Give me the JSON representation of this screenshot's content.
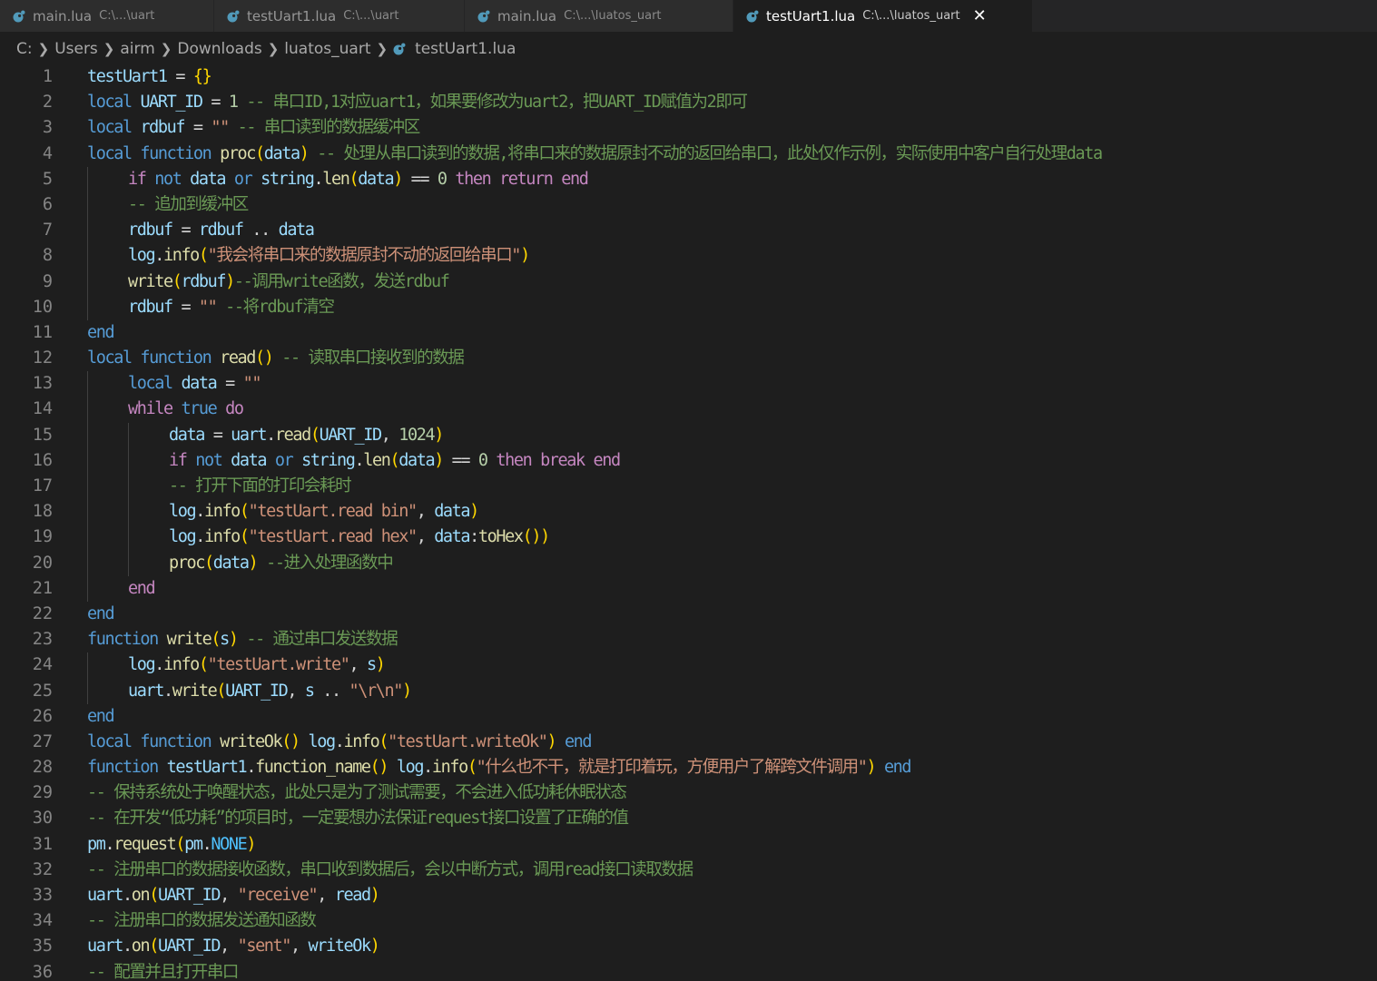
{
  "tabs": [
    {
      "name": "main.lua",
      "path": "C:\\...\\uart",
      "active": false
    },
    {
      "name": "testUart1.lua",
      "path": "C:\\...\\uart",
      "active": false
    },
    {
      "name": "main.lua",
      "path": "C:\\...\\luatos_uart",
      "active": false
    },
    {
      "name": "testUart1.lua",
      "path": "C:\\...\\luatos_uart",
      "active": true
    }
  ],
  "breadcrumb": [
    "C:",
    "Users",
    "airm",
    "Downloads",
    "luatos_uart",
    "testUart1.lua"
  ],
  "colors": {
    "editor_bg": "#1e1e1e",
    "lua_icon": "#519aba"
  },
  "editor": {
    "lines": [
      {
        "n": "1",
        "i": 0,
        "t": [
          [
            "var",
            "testUart1"
          ],
          [
            "op",
            " = "
          ],
          [
            "br",
            "{}"
          ]
        ]
      },
      {
        "n": "2",
        "i": 0,
        "t": [
          [
            "kw",
            "local "
          ],
          [
            "var",
            "UART_ID"
          ],
          [
            "op",
            " = "
          ],
          [
            "num",
            "1"
          ],
          [
            "cm",
            " -- 串口ID,1对应uart1，如果要修改为uart2，把UART_ID赋值为2即可"
          ]
        ]
      },
      {
        "n": "3",
        "i": 0,
        "t": [
          [
            "kw",
            "local "
          ],
          [
            "var",
            "rdbuf"
          ],
          [
            "op",
            " = "
          ],
          [
            "str",
            "\"\""
          ],
          [
            "cm",
            " -- 串口读到的数据缓冲区"
          ]
        ]
      },
      {
        "n": "4",
        "i": 0,
        "t": [
          [
            "kw",
            "local function "
          ],
          [
            "fn",
            "proc"
          ],
          [
            "br",
            "("
          ],
          [
            "var",
            "data"
          ],
          [
            "br",
            ")"
          ],
          [
            "cm",
            " -- 处理从串口读到的数据,将串口来的数据原封不动的返回给串口，此处仅作示例，实际使用中客户自行处理data"
          ]
        ]
      },
      {
        "n": "5",
        "i": 1,
        "t": [
          [
            "ctl",
            "if "
          ],
          [
            "kw",
            "not "
          ],
          [
            "var",
            "data"
          ],
          [
            "kw",
            " or "
          ],
          [
            "var",
            "string"
          ],
          [
            "op",
            "."
          ],
          [
            "fn",
            "len"
          ],
          [
            "br",
            "("
          ],
          [
            "var",
            "data"
          ],
          [
            "br",
            ")"
          ],
          [
            "op",
            " == "
          ],
          [
            "num",
            "0"
          ],
          [
            "ctl",
            " then return end"
          ]
        ]
      },
      {
        "n": "6",
        "i": 1,
        "t": [
          [
            "cm",
            "-- 追加到缓冲区"
          ]
        ]
      },
      {
        "n": "7",
        "i": 1,
        "t": [
          [
            "var",
            "rdbuf"
          ],
          [
            "op",
            " = "
          ],
          [
            "var",
            "rdbuf"
          ],
          [
            "op",
            " .. "
          ],
          [
            "var",
            "data"
          ]
        ]
      },
      {
        "n": "8",
        "i": 1,
        "t": [
          [
            "var",
            "log"
          ],
          [
            "op",
            "."
          ],
          [
            "fn",
            "info"
          ],
          [
            "br",
            "("
          ],
          [
            "str",
            "\"我会将串口来的数据原封不动的返回给串口\""
          ],
          [
            "br",
            ")"
          ]
        ]
      },
      {
        "n": "9",
        "i": 1,
        "t": [
          [
            "fn",
            "write"
          ],
          [
            "br",
            "("
          ],
          [
            "var",
            "rdbuf"
          ],
          [
            "br",
            ")"
          ],
          [
            "cm",
            "--调用write函数，发送rdbuf"
          ]
        ]
      },
      {
        "n": "10",
        "i": 1,
        "t": [
          [
            "var",
            "rdbuf"
          ],
          [
            "op",
            " = "
          ],
          [
            "str",
            "\"\""
          ],
          [
            "cm",
            " --将rdbuf清空"
          ]
        ]
      },
      {
        "n": "11",
        "i": 0,
        "t": [
          [
            "kw",
            "end"
          ]
        ]
      },
      {
        "n": "12",
        "i": 0,
        "t": [
          [
            "kw",
            "local function "
          ],
          [
            "fn",
            "read"
          ],
          [
            "br",
            "()"
          ],
          [
            "cm",
            " -- 读取串口接收到的数据"
          ]
        ]
      },
      {
        "n": "13",
        "i": 1,
        "t": [
          [
            "kw",
            "local "
          ],
          [
            "var",
            "data"
          ],
          [
            "op",
            " = "
          ],
          [
            "str",
            "\"\""
          ]
        ]
      },
      {
        "n": "14",
        "i": 1,
        "t": [
          [
            "ctl",
            "while "
          ],
          [
            "kw",
            "true "
          ],
          [
            "ctl",
            "do"
          ]
        ]
      },
      {
        "n": "15",
        "i": 2,
        "t": [
          [
            "var",
            "data"
          ],
          [
            "op",
            " = "
          ],
          [
            "var",
            "uart"
          ],
          [
            "op",
            "."
          ],
          [
            "fn",
            "read"
          ],
          [
            "br",
            "("
          ],
          [
            "var",
            "UART_ID"
          ],
          [
            "op",
            ", "
          ],
          [
            "num",
            "1024"
          ],
          [
            "br",
            ")"
          ]
        ]
      },
      {
        "n": "16",
        "i": 2,
        "t": [
          [
            "ctl",
            "if "
          ],
          [
            "kw",
            "not "
          ],
          [
            "var",
            "data"
          ],
          [
            "kw",
            " or "
          ],
          [
            "var",
            "string"
          ],
          [
            "op",
            "."
          ],
          [
            "fn",
            "len"
          ],
          [
            "br",
            "("
          ],
          [
            "var",
            "data"
          ],
          [
            "br",
            ")"
          ],
          [
            "op",
            " == "
          ],
          [
            "num",
            "0"
          ],
          [
            "ctl",
            " then break end"
          ]
        ]
      },
      {
        "n": "17",
        "i": 2,
        "t": [
          [
            "cm",
            "-- 打开下面的打印会耗时"
          ]
        ]
      },
      {
        "n": "18",
        "i": 2,
        "t": [
          [
            "var",
            "log"
          ],
          [
            "op",
            "."
          ],
          [
            "fn",
            "info"
          ],
          [
            "br",
            "("
          ],
          [
            "str",
            "\"testUart.read bin\""
          ],
          [
            "op",
            ", "
          ],
          [
            "var",
            "data"
          ],
          [
            "br",
            ")"
          ]
        ]
      },
      {
        "n": "19",
        "i": 2,
        "t": [
          [
            "var",
            "log"
          ],
          [
            "op",
            "."
          ],
          [
            "fn",
            "info"
          ],
          [
            "br",
            "("
          ],
          [
            "str",
            "\"testUart.read hex\""
          ],
          [
            "op",
            ", "
          ],
          [
            "var",
            "data"
          ],
          [
            "op",
            ":"
          ],
          [
            "fn",
            "toHex"
          ],
          [
            "br",
            "()"
          ],
          [
            "br",
            ")"
          ]
        ]
      },
      {
        "n": "20",
        "i": 2,
        "t": [
          [
            "fn",
            "proc"
          ],
          [
            "br",
            "("
          ],
          [
            "var",
            "data"
          ],
          [
            "br",
            ")"
          ],
          [
            "cm",
            " --进入处理函数中"
          ]
        ]
      },
      {
        "n": "21",
        "i": 1,
        "t": [
          [
            "ctl",
            "end"
          ]
        ]
      },
      {
        "n": "22",
        "i": 0,
        "t": [
          [
            "kw",
            "end"
          ]
        ]
      },
      {
        "n": "23",
        "i": 0,
        "t": [
          [
            "kw",
            "function "
          ],
          [
            "fn",
            "write"
          ],
          [
            "br",
            "("
          ],
          [
            "var",
            "s"
          ],
          [
            "br",
            ")"
          ],
          [
            "cm",
            " -- 通过串口发送数据"
          ]
        ]
      },
      {
        "n": "24",
        "i": 1,
        "t": [
          [
            "var",
            "log"
          ],
          [
            "op",
            "."
          ],
          [
            "fn",
            "info"
          ],
          [
            "br",
            "("
          ],
          [
            "str",
            "\"testUart.write\""
          ],
          [
            "op",
            ", "
          ],
          [
            "var",
            "s"
          ],
          [
            "br",
            ")"
          ]
        ]
      },
      {
        "n": "25",
        "i": 1,
        "t": [
          [
            "var",
            "uart"
          ],
          [
            "op",
            "."
          ],
          [
            "fn",
            "write"
          ],
          [
            "br",
            "("
          ],
          [
            "var",
            "UART_ID"
          ],
          [
            "op",
            ", "
          ],
          [
            "var",
            "s"
          ],
          [
            "op",
            " .. "
          ],
          [
            "str",
            "\"\\r\\n\""
          ],
          [
            "br",
            ")"
          ]
        ]
      },
      {
        "n": "26",
        "i": 0,
        "t": [
          [
            "kw",
            "end"
          ]
        ]
      },
      {
        "n": "27",
        "i": 0,
        "t": [
          [
            "kw",
            "local function "
          ],
          [
            "fn",
            "writeOk"
          ],
          [
            "br",
            "()"
          ],
          [
            "op",
            " "
          ],
          [
            "var",
            "log"
          ],
          [
            "op",
            "."
          ],
          [
            "fn",
            "info"
          ],
          [
            "br",
            "("
          ],
          [
            "str",
            "\"testUart.writeOk\""
          ],
          [
            "br",
            ")"
          ],
          [
            "kw",
            " end"
          ]
        ]
      },
      {
        "n": "28",
        "i": 0,
        "t": [
          [
            "kw",
            "function "
          ],
          [
            "var",
            "testUart1"
          ],
          [
            "op",
            "."
          ],
          [
            "fn",
            "function_name"
          ],
          [
            "br",
            "()"
          ],
          [
            "op",
            " "
          ],
          [
            "var",
            "log"
          ],
          [
            "op",
            "."
          ],
          [
            "fn",
            "info"
          ],
          [
            "br",
            "("
          ],
          [
            "str",
            "\"什么也不干，就是打印着玩，方便用户了解跨文件调用\""
          ],
          [
            "br",
            ")"
          ],
          [
            "kw",
            " end"
          ]
        ]
      },
      {
        "n": "29",
        "i": 0,
        "t": [
          [
            "cm",
            "-- 保持系统处于唤醒状态，此处只是为了测试需要，不会进入低功耗休眠状态"
          ]
        ]
      },
      {
        "n": "30",
        "i": 0,
        "t": [
          [
            "cm",
            "-- 在开发“低功耗”的项目时，一定要想办法保证request接口设置了正确的值"
          ]
        ]
      },
      {
        "n": "31",
        "i": 0,
        "t": [
          [
            "var",
            "pm"
          ],
          [
            "op",
            "."
          ],
          [
            "fn",
            "request"
          ],
          [
            "br",
            "("
          ],
          [
            "var",
            "pm"
          ],
          [
            "op",
            "."
          ],
          [
            "cst",
            "NONE"
          ],
          [
            "br",
            ")"
          ]
        ]
      },
      {
        "n": "32",
        "i": 0,
        "t": [
          [
            "cm",
            "-- 注册串口的数据接收函数，串口收到数据后，会以中断方式，调用read接口读取数据"
          ]
        ]
      },
      {
        "n": "33",
        "i": 0,
        "t": [
          [
            "var",
            "uart"
          ],
          [
            "op",
            "."
          ],
          [
            "fn",
            "on"
          ],
          [
            "br",
            "("
          ],
          [
            "var",
            "UART_ID"
          ],
          [
            "op",
            ", "
          ],
          [
            "str",
            "\"receive\""
          ],
          [
            "op",
            ", "
          ],
          [
            "var",
            "read"
          ],
          [
            "br",
            ")"
          ]
        ]
      },
      {
        "n": "34",
        "i": 0,
        "t": [
          [
            "cm",
            "-- 注册串口的数据发送通知函数"
          ]
        ]
      },
      {
        "n": "35",
        "i": 0,
        "t": [
          [
            "var",
            "uart"
          ],
          [
            "op",
            "."
          ],
          [
            "fn",
            "on"
          ],
          [
            "br",
            "("
          ],
          [
            "var",
            "UART_ID"
          ],
          [
            "op",
            ", "
          ],
          [
            "str",
            "\"sent\""
          ],
          [
            "op",
            ", "
          ],
          [
            "var",
            "writeOk"
          ],
          [
            "br",
            ")"
          ]
        ]
      },
      {
        "n": "36",
        "i": 0,
        "t": [
          [
            "cm",
            "-- 配置并且打开串口"
          ]
        ]
      }
    ]
  }
}
